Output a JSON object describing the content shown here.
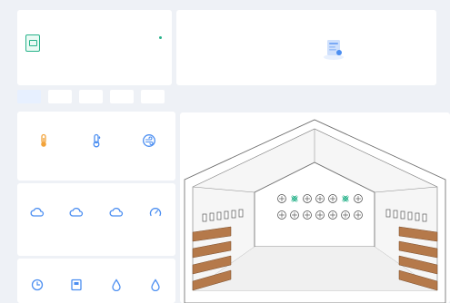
{
  "device": {
    "title": "",
    "name": "",
    "type": "",
    "serial": "",
    "status": ""
  },
  "alarms": {
    "title": "",
    "empty_text": ""
  },
  "tabs": [
    {
      "label": ""
    },
    {
      "label": ""
    },
    {
      "label": ""
    },
    {
      "label": ""
    },
    {
      "label": ""
    }
  ],
  "environment": {
    "title": "",
    "metrics": [
      {
        "icon": "thermometer-icon",
        "value": "",
        "label": ""
      },
      {
        "icon": "humidity-icon",
        "value": "",
        "label": ""
      },
      {
        "icon": "wind-icon",
        "value": "",
        "label": ""
      }
    ]
  },
  "gas": {
    "title": "",
    "metrics": [
      {
        "icon": "cloud-icon",
        "value": "",
        "label": ""
      },
      {
        "icon": "cloud-icon",
        "value": "",
        "label": ""
      },
      {
        "icon": "cloud-icon",
        "value": "",
        "label": ""
      },
      {
        "icon": "pressure-icon",
        "value": "",
        "label": ""
      }
    ]
  },
  "light": {
    "title": "",
    "metrics": [
      {
        "icon": "clock-icon",
        "value": "",
        "label": ""
      },
      {
        "icon": "water-meter-icon",
        "value": "",
        "label": ""
      },
      {
        "icon": "water-drop-icon",
        "value": "",
        "label": ""
      },
      {
        "icon": "water-drop-icon",
        "value": "",
        "label": ""
      }
    ]
  },
  "barn": {
    "temp_top": "",
    "temp_ridge": "",
    "temp_floor_right": "",
    "temp_floor_right2": "",
    "temp_floor_left": "",
    "temp_floor_far_right": ""
  },
  "colors": {
    "accent": "#2f7cf6",
    "online": "#27b28a",
    "fan_active": "#27b28a",
    "cage": "#b5794a",
    "icon_orange": "#f2a33a",
    "icon_blue": "#4b8ef1"
  }
}
